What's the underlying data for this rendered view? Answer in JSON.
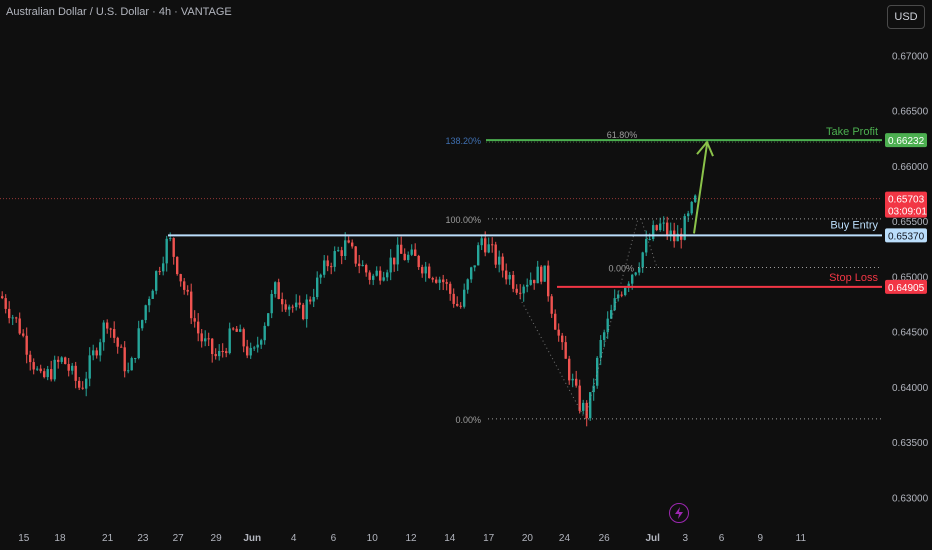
{
  "header": {
    "title": "Australian Dollar / U.S. Dollar · 4h · VANTAGE",
    "currency": "USD"
  },
  "colors": {
    "bg": "#0f0f0f",
    "up": "#26a69a",
    "down": "#ef5350",
    "take_profit": "#4caf50",
    "buy_entry": "#bbdefb",
    "stop_loss": "#f23645",
    "fib": "#9e9e9e",
    "arrow": "#8bc34a"
  },
  "chart_data": {
    "type": "candlestick",
    "symbol": "AUDUSD",
    "timeframe": "4h",
    "ylim": [
      0.6275,
      0.675
    ],
    "y_ticks": [
      "0.67000",
      "0.66500",
      "0.66000",
      "0.65500",
      "0.65000",
      "0.64500",
      "0.64000",
      "0.63500",
      "0.63000"
    ],
    "x_ticks": [
      "15",
      "18",
      "21",
      "23",
      "27",
      "29",
      "Jun",
      "4",
      "6",
      "10",
      "12",
      "14",
      "17",
      "20",
      "24",
      "26",
      "Jul",
      "3",
      "6",
      "9",
      "11"
    ],
    "x_tick_fracs": [
      0.027,
      0.068,
      0.122,
      0.162,
      0.202,
      0.245,
      0.286,
      0.333,
      0.378,
      0.422,
      0.466,
      0.51,
      0.554,
      0.598,
      0.64,
      0.685,
      0.74,
      0.777,
      0.818,
      0.862,
      0.908
    ],
    "current_price": {
      "price": "0.65703",
      "countdown": "03:09:01",
      "value": 0.65703
    },
    "levels": [
      {
        "name": "Take Profit",
        "label": "Take Profit",
        "price_text": "0.66232",
        "value": 0.66232
      },
      {
        "name": "Buy Entry",
        "label": "Buy Entry",
        "price_text": "0.65370",
        "value": 0.6537
      },
      {
        "name": "Stop Loss",
        "label": "Stop Loss",
        "price_text": "0.64905",
        "value": 0.64905
      }
    ],
    "fib_labels": [
      {
        "text": "138.20%",
        "value": 0.66232
      },
      {
        "text": "61.80%",
        "value": 0.66232
      },
      {
        "text": "100.00%",
        "value": 0.6552
      },
      {
        "text": "0.00%",
        "value": 0.6508
      },
      {
        "text": "0.00%",
        "value": 0.6371
      }
    ],
    "candle_waypoints": [
      [
        0.0,
        0.6482
      ],
      [
        0.02,
        0.6455
      ],
      [
        0.045,
        0.6405
      ],
      [
        0.07,
        0.6425
      ],
      [
        0.09,
        0.6398
      ],
      [
        0.12,
        0.6462
      ],
      [
        0.145,
        0.641
      ],
      [
        0.165,
        0.6478
      ],
      [
        0.19,
        0.6535
      ],
      [
        0.205,
        0.6495
      ],
      [
        0.225,
        0.6445
      ],
      [
        0.245,
        0.6425
      ],
      [
        0.265,
        0.6452
      ],
      [
        0.285,
        0.6425
      ],
      [
        0.31,
        0.6488
      ],
      [
        0.34,
        0.6465
      ],
      [
        0.37,
        0.6512
      ],
      [
        0.39,
        0.6528
      ],
      [
        0.42,
        0.6498
      ],
      [
        0.45,
        0.652
      ],
      [
        0.47,
        0.6515
      ],
      [
        0.5,
        0.6497
      ],
      [
        0.52,
        0.647
      ],
      [
        0.545,
        0.6535
      ],
      [
        0.565,
        0.651
      ],
      [
        0.585,
        0.6492
      ],
      [
        0.615,
        0.6505
      ],
      [
        0.635,
        0.6435
      ],
      [
        0.655,
        0.6385
      ],
      [
        0.665,
        0.6375
      ],
      [
        0.68,
        0.644
      ],
      [
        0.7,
        0.6485
      ],
      [
        0.72,
        0.651
      ],
      [
        0.738,
        0.6538
      ],
      [
        0.748,
        0.6546
      ],
      [
        0.765,
        0.6532
      ],
      [
        0.778,
        0.655
      ],
      [
        0.788,
        0.657
      ]
    ]
  }
}
